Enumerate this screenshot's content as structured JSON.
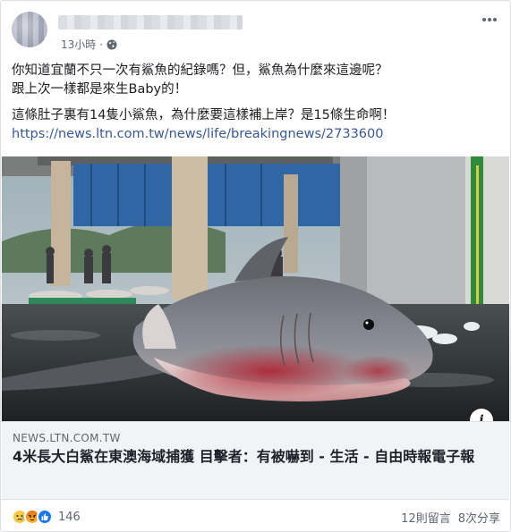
{
  "post": {
    "time": "13小時",
    "separator": "·",
    "text_line1": "你知道宜蘭不只一次有鯊魚的紀錄嗎？但，鯊魚為什麼來這邊呢？",
    "text_line2": "跟上次一樣都是來生Baby的！",
    "text_line3": "這條肚子裏有14隻小鯊魚，為什麼要這樣補上岸？是15條生命啊！",
    "link_url": "https://news.ltn.com.tw/news/life/breakingnews/2733600"
  },
  "link_preview": {
    "domain": "NEWS.LTN.COM.TW",
    "headline": "4米長大白鯊在東澳海域捕獲 目擊者：有被嚇到 - 生活 - 自由時報電子報",
    "info_glyph": "i"
  },
  "footer": {
    "reaction_count": "146",
    "comments": "12則留言",
    "shares": "8次分享"
  },
  "icons": [
    "more-options-icon",
    "globe-icon",
    "info-icon",
    "sad-reaction-icon",
    "angry-reaction-icon",
    "like-reaction-icon"
  ],
  "colors": {
    "link": "#385898",
    "like_blue": "#1877f2",
    "meta_gray": "#606770"
  }
}
